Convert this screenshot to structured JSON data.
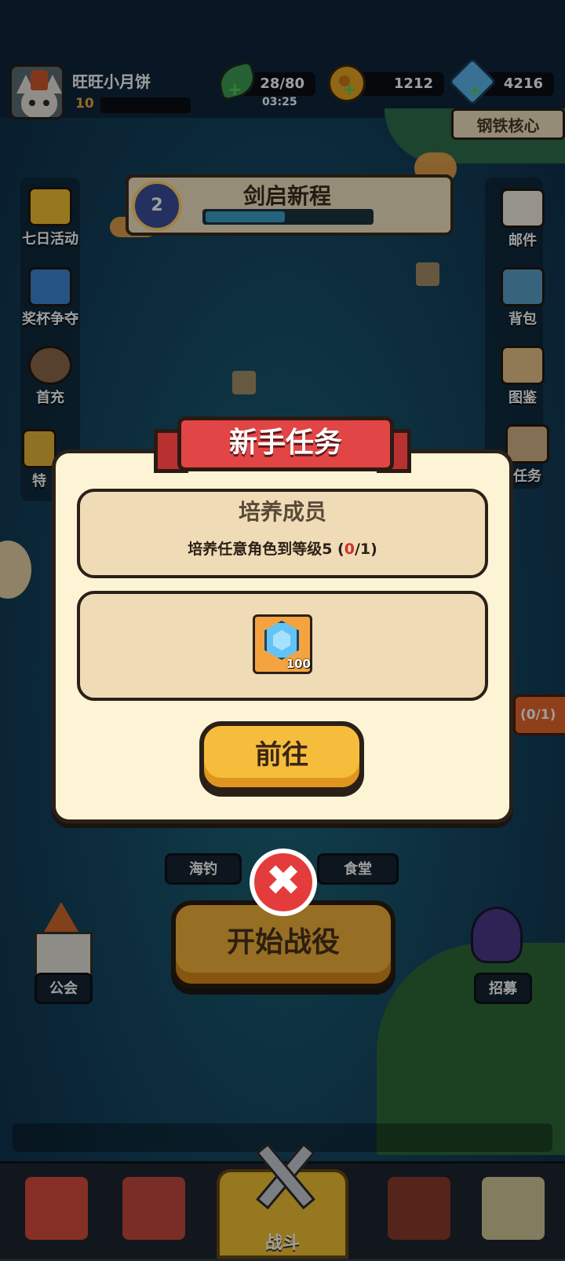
{
  "player": {
    "name": "旺旺小月饼",
    "level": "10"
  },
  "resources": {
    "energy": "28/80",
    "energy_timer": "03:25",
    "gold": "1212",
    "gems": "4216"
  },
  "top_right_banner": "钢铁核心",
  "quest_banner": {
    "badge": "2",
    "title": "剑启新程",
    "progress": 0.48
  },
  "left_menu": [
    "七日活动",
    "奖杯争夺",
    "首充",
    "特"
  ],
  "right_menu": [
    "邮件",
    "背包",
    "图鉴",
    "任务"
  ],
  "side_tag_progress": "(0/1)",
  "modal": {
    "title": "新手任务",
    "task_title": "培养成员",
    "task_desc_prefix": "培养任意角色到等级5 (",
    "task_current": "0",
    "task_desc_suffix": "/1)",
    "reward_count": "100",
    "go_button": "前往",
    "close_symbol": "✖"
  },
  "bottom": {
    "fishing": "海钓",
    "canteen": "食堂",
    "start_battle": "开始战役",
    "guild": "公会",
    "recruit": "招募"
  },
  "nav": {
    "battle": "战斗"
  },
  "colors": {
    "ribbon": "#e24545",
    "button": "#f6bd3c",
    "gem": "#63c3f5"
  }
}
